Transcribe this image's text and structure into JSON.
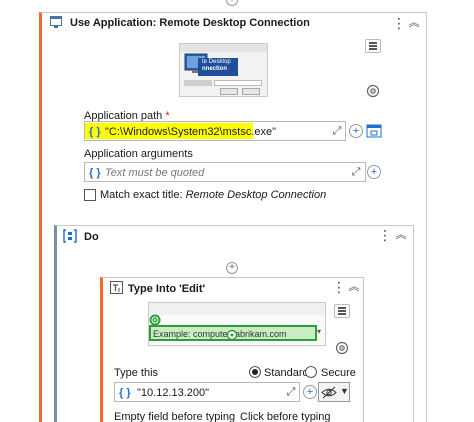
{
  "use_app": {
    "title": "Use Application: Remote Desktop Connection",
    "path_label": "Application path",
    "path_required": "*",
    "path_value": "\"C:\\Windows\\System32\\mstsc.exe\"",
    "args_label": "Application arguments",
    "args_placeholder": "Text must be quoted",
    "match_label": "Match exact title:",
    "match_value": "Remote Desktop Connection",
    "thumb_text_line1": "te Desktop",
    "thumb_text_line2": "nnection"
  },
  "do": {
    "title": "Do"
  },
  "type_into": {
    "title": "Type Into 'Edit'",
    "thumb_example": "Example: computer.fabrikam.com",
    "type_this_label": "Type this",
    "type_this_value": "\"10.12.13.200\"",
    "radio_standard": "Standard",
    "radio_secure": "Secure",
    "empty_field_label": "Empty field before typing",
    "click_before_label": "Click before typing"
  },
  "icons": {
    "brace": "{ }",
    "expand": "⤢",
    "plus": "+",
    "kebab": "⋮",
    "collapse": "︽",
    "add": "⊕"
  },
  "colors": {
    "accent_orange": "#f26b2a",
    "brace_blue": "#1f6fd1",
    "highlight_yellow": "#ffff00",
    "target_green": "#2e9e3a"
  }
}
